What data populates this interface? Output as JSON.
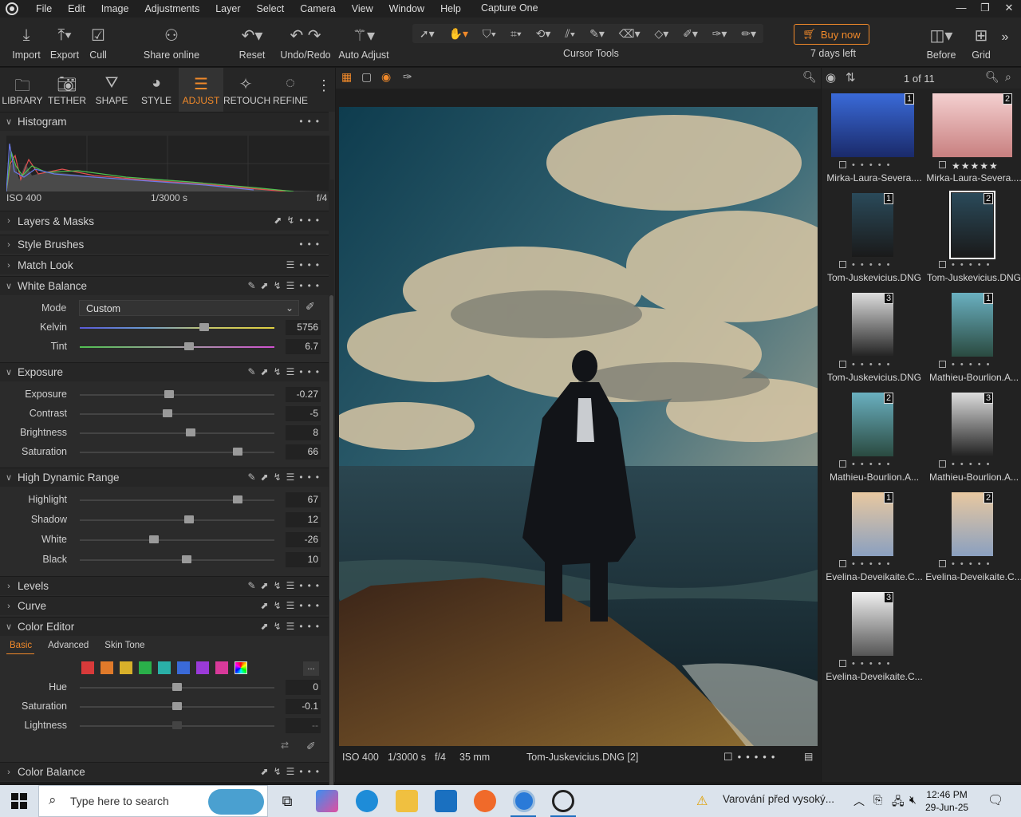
{
  "menubar": {
    "items": [
      "File",
      "Edit",
      "Image",
      "Adjustments",
      "Layer",
      "Select",
      "Camera",
      "View",
      "Window",
      "Help"
    ],
    "title": "Capture One"
  },
  "toolbar": {
    "import": "Import",
    "export": "Export",
    "cull": "Cull",
    "share": "Share online",
    "reset": "Reset",
    "undo_redo": "Undo/Redo",
    "auto_adjust": "Auto Adjust",
    "cursor_tools": "Cursor Tools",
    "buy_now": "Buy now",
    "days_left": "7 days left",
    "before": "Before",
    "grid": "Grid"
  },
  "tool_tabs": [
    {
      "label": "LIBRARY",
      "icon": "folder-icon"
    },
    {
      "label": "TETHER",
      "icon": "camera-icon"
    },
    {
      "label": "SHAPE",
      "icon": "lens-icon"
    },
    {
      "label": "STYLE",
      "icon": "palette-icon"
    },
    {
      "label": "ADJUST",
      "icon": "sliders-icon",
      "active": true
    },
    {
      "label": "RETOUCH",
      "icon": "sparkle-icon"
    },
    {
      "label": "REFINE",
      "icon": "refine-icon"
    }
  ],
  "histogram": {
    "title": "Histogram",
    "iso": "ISO 400",
    "shutter": "1/3000 s",
    "aperture": "f/4"
  },
  "sections": {
    "layers": "Layers & Masks",
    "style_brushes": "Style Brushes",
    "match_look": "Match Look",
    "white_balance": "White Balance",
    "exposure": "Exposure",
    "hdr": "High Dynamic Range",
    "levels": "Levels",
    "curve": "Curve",
    "color_editor": "Color Editor",
    "color_balance": "Color Balance"
  },
  "white_balance": {
    "mode_label": "Mode",
    "mode_value": "Custom",
    "sliders": [
      {
        "label": "Kelvin",
        "value": "5756",
        "pos": 0.64
      },
      {
        "label": "Tint",
        "value": "6.7",
        "pos": 0.56
      }
    ]
  },
  "exposure": {
    "sliders": [
      {
        "label": "Exposure",
        "value": "-0.27",
        "pos": 0.46
      },
      {
        "label": "Contrast",
        "value": "-5",
        "pos": 0.45
      },
      {
        "label": "Brightness",
        "value": "8",
        "pos": 0.57
      },
      {
        "label": "Saturation",
        "value": "66",
        "pos": 0.81
      }
    ]
  },
  "hdr": {
    "sliders": [
      {
        "label": "Highlight",
        "value": "67",
        "pos": 0.81
      },
      {
        "label": "Shadow",
        "value": "12",
        "pos": 0.56
      },
      {
        "label": "White",
        "value": "-26",
        "pos": 0.38
      },
      {
        "label": "Black",
        "value": "10",
        "pos": 0.55
      }
    ]
  },
  "color_editor": {
    "tabs": [
      "Basic",
      "Advanced",
      "Skin Tone"
    ],
    "swatches": [
      "#d83a3a",
      "#e07a2a",
      "#d8b02a",
      "#2ab04a",
      "#2ab0a8",
      "#3a6ad8",
      "#9a3ad8",
      "#d83a9a"
    ],
    "more": "...",
    "sliders": [
      {
        "label": "Hue",
        "value": "0",
        "pos": 0.5
      },
      {
        "label": "Saturation",
        "value": "-0.1",
        "pos": 0.5
      },
      {
        "label": "Lightness",
        "value": "--",
        "pos": 0.5
      }
    ]
  },
  "viewer": {
    "iso": "ISO 400",
    "shutter": "1/3000 s",
    "aperture": "f/4",
    "focal": "35 mm",
    "filename": "Tom-Juskevicius.DNG [2]"
  },
  "browser": {
    "count": "1 of 11",
    "thumbs": [
      {
        "name": "Mirka-Laura-Severa....",
        "num": "1",
        "style": "blue"
      },
      {
        "name": "Mirka-Laura-Severa....",
        "num": "2",
        "style": "pink",
        "stars": "★★★★★"
      },
      {
        "name": "Tom-Juskevicius.DNG",
        "num": "1",
        "style": "dark"
      },
      {
        "name": "Tom-Juskevicius.DNG",
        "num": "2",
        "style": "dark",
        "selected": true
      },
      {
        "name": "Tom-Juskevicius.DNG",
        "num": "3",
        "style": "bw"
      },
      {
        "name": "Mathieu-Bourlion.A...",
        "num": "1",
        "style": "teal"
      },
      {
        "name": "Mathieu-Bourlion.A...",
        "num": "2",
        "style": "teal"
      },
      {
        "name": "Mathieu-Bourlion.A...",
        "num": "3",
        "style": "bw"
      },
      {
        "name": "Evelina-Deveikaite.C...",
        "num": "1",
        "style": "face"
      },
      {
        "name": "Evelina-Deveikaite.C...",
        "num": "2",
        "style": "face"
      },
      {
        "name": "Evelina-Deveikaite.C...",
        "num": "3",
        "style": "bwface"
      }
    ]
  },
  "taskbar": {
    "search_placeholder": "Type here to search",
    "notification": "Varování před vysoký...",
    "time": "12:46 PM",
    "date": "29-Jun-25"
  }
}
